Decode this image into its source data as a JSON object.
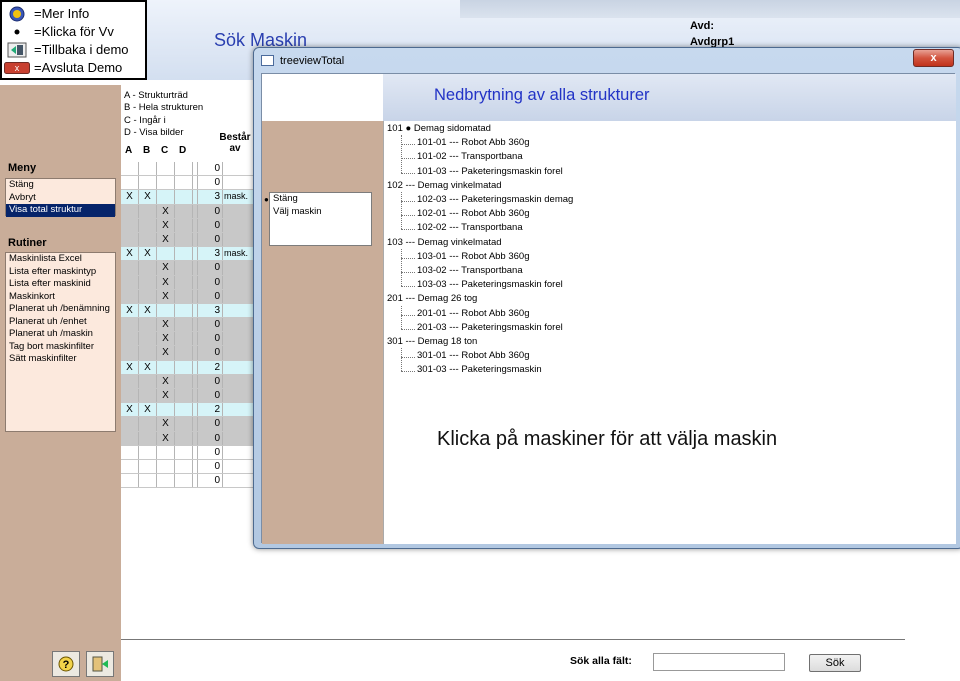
{
  "legend": [
    {
      "icon": "info-icon",
      "text": "=Mer Info"
    },
    {
      "icon": "dot-icon",
      "text": "=Klicka för Vv"
    },
    {
      "icon": "back-icon",
      "text": "=Tillbaka i demo"
    },
    {
      "icon": "close-demo-icon",
      "text": "=Avsluta Demo"
    }
  ],
  "header": {
    "title": "Sök Maskin",
    "avd_label": "Avd:",
    "avdgrp_label": "Avdgrp1"
  },
  "sidebar": {
    "menu_heading": "Meny",
    "menu_items": [
      "Stäng",
      "Avbryt",
      "Visa total struktur"
    ],
    "menu_selected": 2,
    "rutiner_heading": "Rutiner",
    "rutiner_items": [
      "Maskinlista Excel",
      "Lista efter maskintyp",
      "Lista efter maskinid",
      "Maskinkort",
      "Planerat uh /benämning",
      "Planerat uh /enhet",
      "Planerat uh /maskin",
      "Tag bort maskinfilter",
      "Sätt maskinfilter"
    ]
  },
  "structure_legend": [
    "A - Strukturträd",
    "B - Hela strukturen",
    "C - Ingår i",
    "D - Visa bilder"
  ],
  "table": {
    "headers": [
      "A",
      "B",
      "C",
      "D"
    ],
    "bestar_label": "Består av",
    "rows": [
      {
        "style": "white",
        "a": "",
        "b": "",
        "c": "",
        "d": "",
        "n": "0",
        "m": ""
      },
      {
        "style": "white",
        "a": "",
        "b": "",
        "c": "",
        "d": "",
        "n": "0",
        "m": ""
      },
      {
        "style": "cyan",
        "a": "X",
        "b": "X",
        "c": "",
        "d": "",
        "n": "3",
        "m": "mask."
      },
      {
        "style": "gray",
        "a": "",
        "b": "",
        "c": "X",
        "d": "",
        "n": "0",
        "m": ""
      },
      {
        "style": "gray",
        "a": "",
        "b": "",
        "c": "X",
        "d": "",
        "n": "0",
        "m": ""
      },
      {
        "style": "gray",
        "a": "",
        "b": "",
        "c": "X",
        "d": "",
        "n": "0",
        "m": ""
      },
      {
        "style": "cyan",
        "a": "X",
        "b": "X",
        "c": "",
        "d": "",
        "n": "3",
        "m": "mask."
      },
      {
        "style": "gray",
        "a": "",
        "b": "",
        "c": "X",
        "d": "",
        "n": "0",
        "m": ""
      },
      {
        "style": "gray",
        "a": "",
        "b": "",
        "c": "X",
        "d": "",
        "n": "0",
        "m": ""
      },
      {
        "style": "gray",
        "a": "",
        "b": "",
        "c": "X",
        "d": "",
        "n": "0",
        "m": ""
      },
      {
        "style": "cyan",
        "a": "X",
        "b": "X",
        "c": "",
        "d": "",
        "n": "3",
        "m": ""
      },
      {
        "style": "gray",
        "a": "",
        "b": "",
        "c": "X",
        "d": "",
        "n": "0",
        "m": ""
      },
      {
        "style": "gray",
        "a": "",
        "b": "",
        "c": "X",
        "d": "",
        "n": "0",
        "m": ""
      },
      {
        "style": "gray",
        "a": "",
        "b": "",
        "c": "X",
        "d": "",
        "n": "0",
        "m": ""
      },
      {
        "style": "cyan",
        "a": "X",
        "b": "X",
        "c": "",
        "d": "",
        "n": "2",
        "m": ""
      },
      {
        "style": "gray",
        "a": "",
        "b": "",
        "c": "X",
        "d": "",
        "n": "0",
        "m": ""
      },
      {
        "style": "gray",
        "a": "",
        "b": "",
        "c": "X",
        "d": "",
        "n": "0",
        "m": ""
      },
      {
        "style": "cyan",
        "a": "X",
        "b": "X",
        "c": "",
        "d": "",
        "n": "2",
        "m": ""
      },
      {
        "style": "gray",
        "a": "",
        "b": "",
        "c": "X",
        "d": "",
        "n": "0",
        "m": ""
      },
      {
        "style": "gray",
        "a": "",
        "b": "",
        "c": "X",
        "d": "",
        "n": "0",
        "m": ""
      },
      {
        "style": "white",
        "a": "",
        "b": "",
        "c": "",
        "d": "",
        "n": "0",
        "m": ""
      },
      {
        "style": "white",
        "a": "",
        "b": "",
        "c": "",
        "d": "",
        "n": "0",
        "m": ""
      },
      {
        "style": "white",
        "a": "",
        "b": "",
        "c": "",
        "d": "",
        "n": "0",
        "m": ""
      }
    ]
  },
  "search": {
    "label": "Sök alla fält:",
    "value": "",
    "button": "Sök"
  },
  "popup": {
    "title": "treeviewTotal",
    "close": "x",
    "heading": "Nedbrytning av alla strukturer",
    "menu_items": [
      "Stäng",
      "Välj maskin"
    ],
    "tree": [
      {
        "label": "101 ● Demag sidomatad",
        "children": [
          "101-01 --- Robot Abb 360g",
          "101-02 --- Transportbana",
          "101-03 --- Paketeringsmaskin forel"
        ]
      },
      {
        "label": "102 --- Demag vinkelmatad",
        "children": [
          "102-03 --- Paketeringsmaskin demag",
          "102-01 --- Robot Abb 360g",
          "102-02 --- Transportbana"
        ]
      },
      {
        "label": "103 --- Demag vinkelmatad",
        "children": [
          "103-01 --- Robot Abb 360g",
          "103-02 --- Transportbana",
          "103-03 --- Paketeringsmaskin forel"
        ]
      },
      {
        "label": "201 --- Demag 26 tog",
        "children": [
          "201-01 --- Robot Abb 360g",
          "201-03 --- Paketeringsmaskin forel"
        ]
      },
      {
        "label": "301 --- Demag 18 ton",
        "children": [
          "301-01 --- Robot Abb 360g",
          "301-03 --- Paketeringsmaskin"
        ]
      }
    ]
  },
  "instruction": "Klicka på maskiner för att välja maskin"
}
